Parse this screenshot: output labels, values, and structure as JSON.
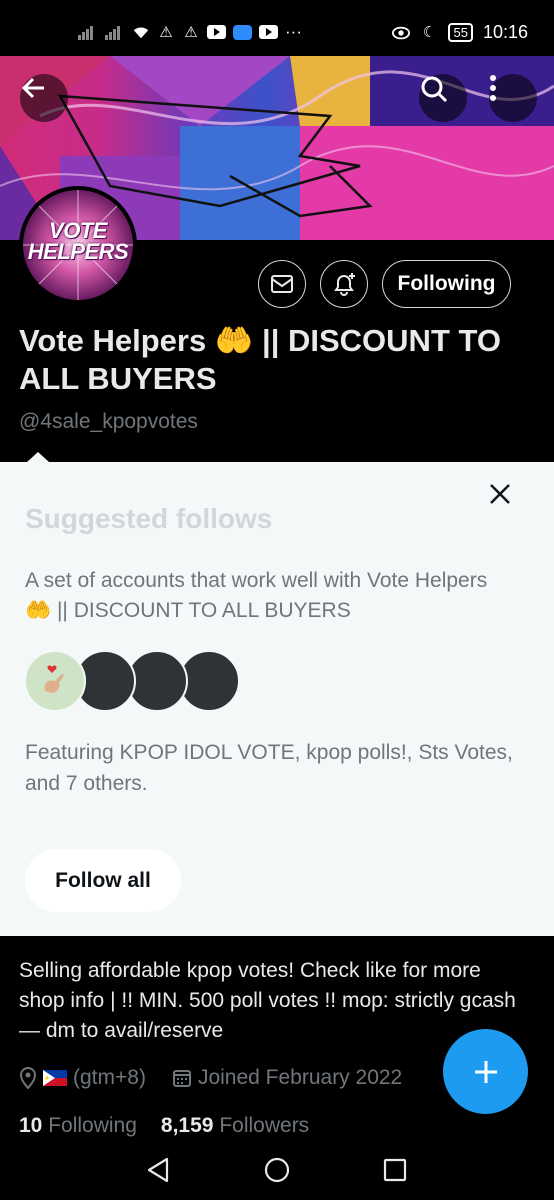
{
  "status_bar": {
    "battery": "55",
    "time": "10:16",
    "overflow": "···"
  },
  "banner": {
    "back_icon": "arrow-left-icon",
    "search_icon": "search-icon",
    "more_icon": "more-vertical-icon"
  },
  "profile": {
    "avatar_text": "VOTE HELPERS",
    "display_name": "Vote Helpers 🤲 || DISCOUNT TO ALL BUYERS",
    "handle": "@4sale_kpopvotes",
    "following_label": "Following"
  },
  "suggested": {
    "title": "Suggested follows",
    "description": "A set of accounts that work well with Vote Helpers 🤲 || DISCOUNT TO ALL BUYERS",
    "featuring": "Featuring KPOP IDOL VOTE, kpop polls!, Sts Votes, and 7 others.",
    "follow_all_label": "Follow all"
  },
  "bio": {
    "text": "Selling affordable kpop votes! Check like for more shop info | !! MIN. 500 poll votes !! mop: strictly gcash — dm to avail/reserve",
    "location": "(gtm+8)",
    "joined": "Joined February 2022"
  },
  "stats": {
    "following_count": "10",
    "following_label": "Following",
    "followers_count": "8,159",
    "followers_label": "Followers"
  },
  "colors": {
    "accent": "#1d9bf0",
    "background": "#000000",
    "sheet": "#f5f8f8"
  }
}
